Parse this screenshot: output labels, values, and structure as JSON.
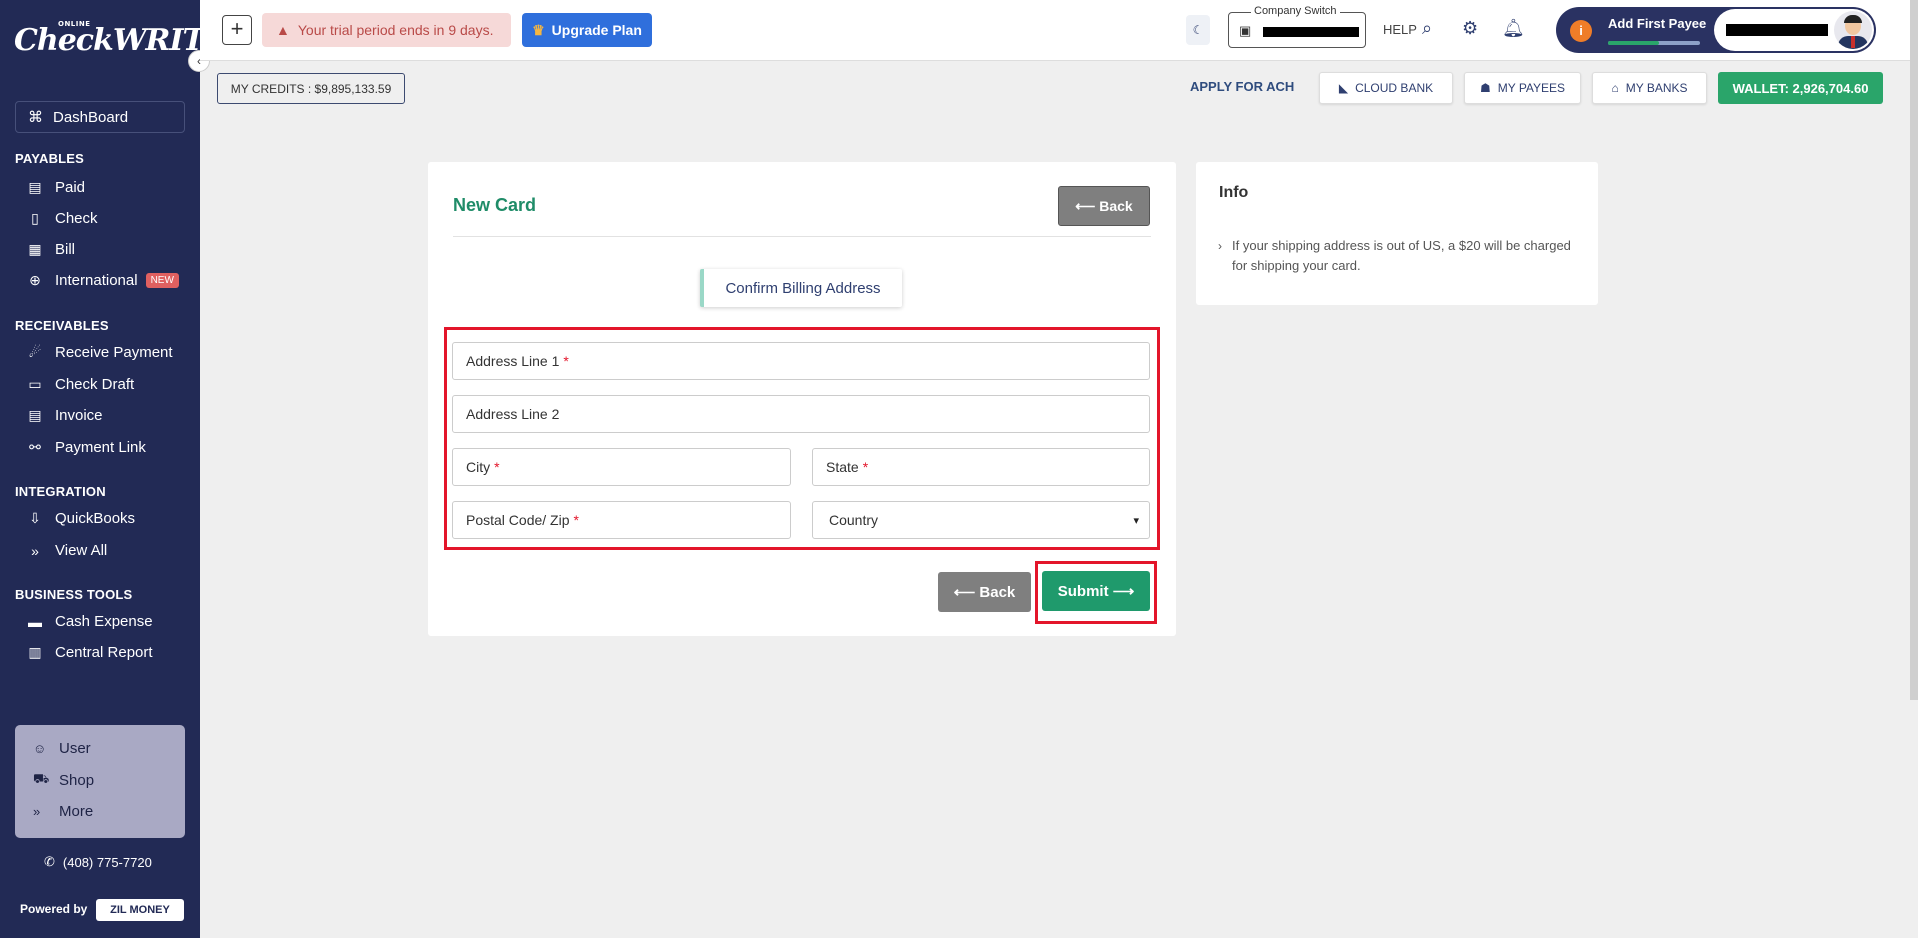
{
  "brand": {
    "online": "ONLINE",
    "name": "CheckWRITER"
  },
  "sidebar": {
    "dashboard": "DashBoard",
    "sections": {
      "payables": "PAYABLES",
      "receivables": "RECEIVABLES",
      "integration": "INTEGRATION",
      "business_tools": "BUSINESS TOOLS"
    },
    "items": {
      "paid": "Paid",
      "check": "Check",
      "bill": "Bill",
      "international": "International",
      "international_badge": "NEW",
      "receive_payment": "Receive Payment",
      "check_draft": "Check Draft",
      "invoice": "Invoice",
      "payment_link": "Payment Link",
      "quickbooks": "QuickBooks",
      "view_all": "View All",
      "cash_expense": "Cash Expense",
      "central_report": "Central Report"
    },
    "bottom": {
      "user": "User",
      "shop": "Shop",
      "more": "More"
    },
    "phone": "(408) 775-7720",
    "powered_by": "Powered by",
    "zil_money": "ZIL MONEY"
  },
  "topbar": {
    "trial_text": "Your trial period ends in 9 days.",
    "upgrade_label": "Upgrade Plan",
    "company_switch_label": "Company Switch",
    "help": "HELP",
    "add_first_payee": "Add First Payee",
    "payee_progress": 0.55
  },
  "subbar": {
    "credits": "MY CREDITS : $9,895,133.59",
    "apply_ach": "APPLY FOR ACH",
    "cloud_bank": "CLOUD BANK",
    "my_payees": "MY PAYEES",
    "my_banks": "MY BANKS",
    "wallet": "WALLET: 2,926,704.60"
  },
  "form": {
    "title": "New Card",
    "back_label": "Back",
    "tab_label": "Confirm Billing Address",
    "address1_label": "Address Line 1",
    "address2_label": "Address Line 2",
    "city_label": "City",
    "state_label": "State",
    "zip_label": "Postal Code/ Zip",
    "country_value": "Country",
    "required_mark": "*",
    "submit_label": "Submit"
  },
  "info": {
    "title": "Info",
    "text": "If your shipping address is out of US, a $20 will be charged for shipping your card."
  },
  "colors": {
    "sidebar_bg": "#222a55",
    "accent_green": "#1f9a6c",
    "highlight_red": "#e3152a",
    "upgrade_blue": "#2f6fdc"
  }
}
